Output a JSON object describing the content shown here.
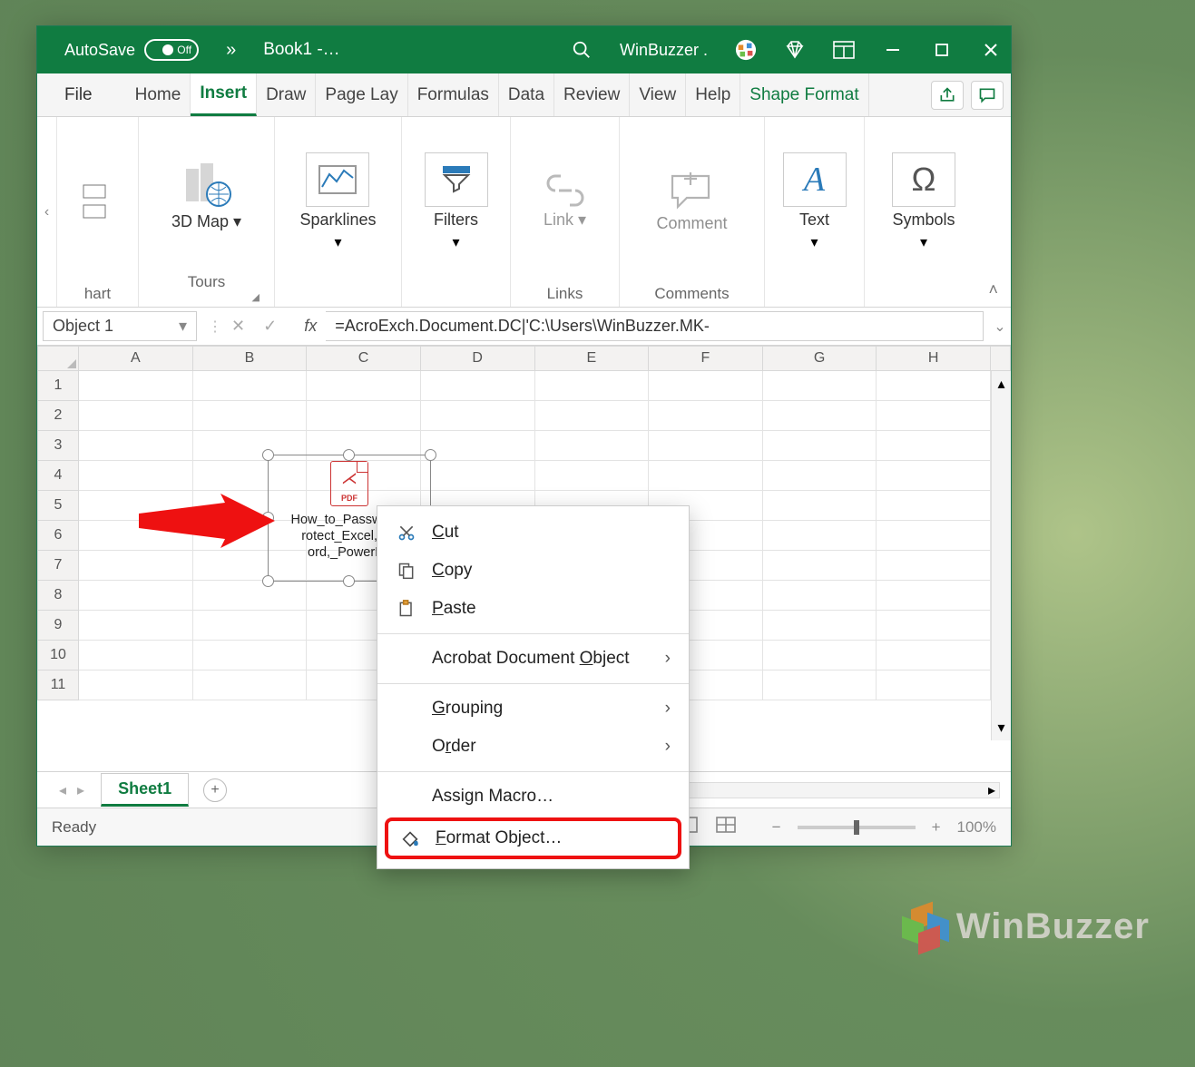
{
  "titlebar": {
    "autosave_label": "AutoSave",
    "autosave_state": "Off",
    "book": "Book1  -…",
    "account": "WinBuzzer ."
  },
  "tabs": {
    "file": "File",
    "items": [
      "Home",
      "Insert",
      "Draw",
      "Page Lay",
      "Formulas",
      "Data",
      "Review",
      "View",
      "Help"
    ],
    "contextual": "Shape Format",
    "active_index": 1
  },
  "ribbon": {
    "scroll_hint": "hart",
    "groups": {
      "tours": {
        "btn": "3D Map",
        "label": "Tours"
      },
      "sparklines": {
        "btn": "Sparklines",
        "label": ""
      },
      "filters": {
        "btn": "Filters",
        "label": ""
      },
      "links": {
        "btn": "Link",
        "label": "Links"
      },
      "comments": {
        "btn": "Comment",
        "label": "Comments"
      },
      "text": {
        "btn": "Text",
        "label": ""
      },
      "symbols": {
        "btn": "Symbols",
        "label": ""
      }
    }
  },
  "formula": {
    "namebox": "Object 1",
    "fx": "fx",
    "value": "=AcroExch.Document.DC|'C:\\Users\\WinBuzzer.MK-"
  },
  "columns": [
    "A",
    "B",
    "C",
    "D",
    "E",
    "F",
    "G",
    "H"
  ],
  "rows": [
    1,
    2,
    3,
    4,
    5,
    6,
    7,
    8,
    9,
    10,
    11
  ],
  "sheet": {
    "name": "Sheet1"
  },
  "status": {
    "ready": "Ready",
    "zoom": "100%"
  },
  "object": {
    "icon_label": "PDF",
    "filename_lines": [
      "How_to_Password_",
      "rotect_Excel,_W",
      "ord,_PowerPo"
    ]
  },
  "contextmenu": {
    "cut": "Cut",
    "copy": "Copy",
    "paste": "Paste",
    "acrobat": "Acrobat Document Object",
    "grouping": "Grouping",
    "order": "Order",
    "assign_macro": "Assign Macro…",
    "format_object": "Format Object…"
  },
  "watermark": "WinBuzzer"
}
